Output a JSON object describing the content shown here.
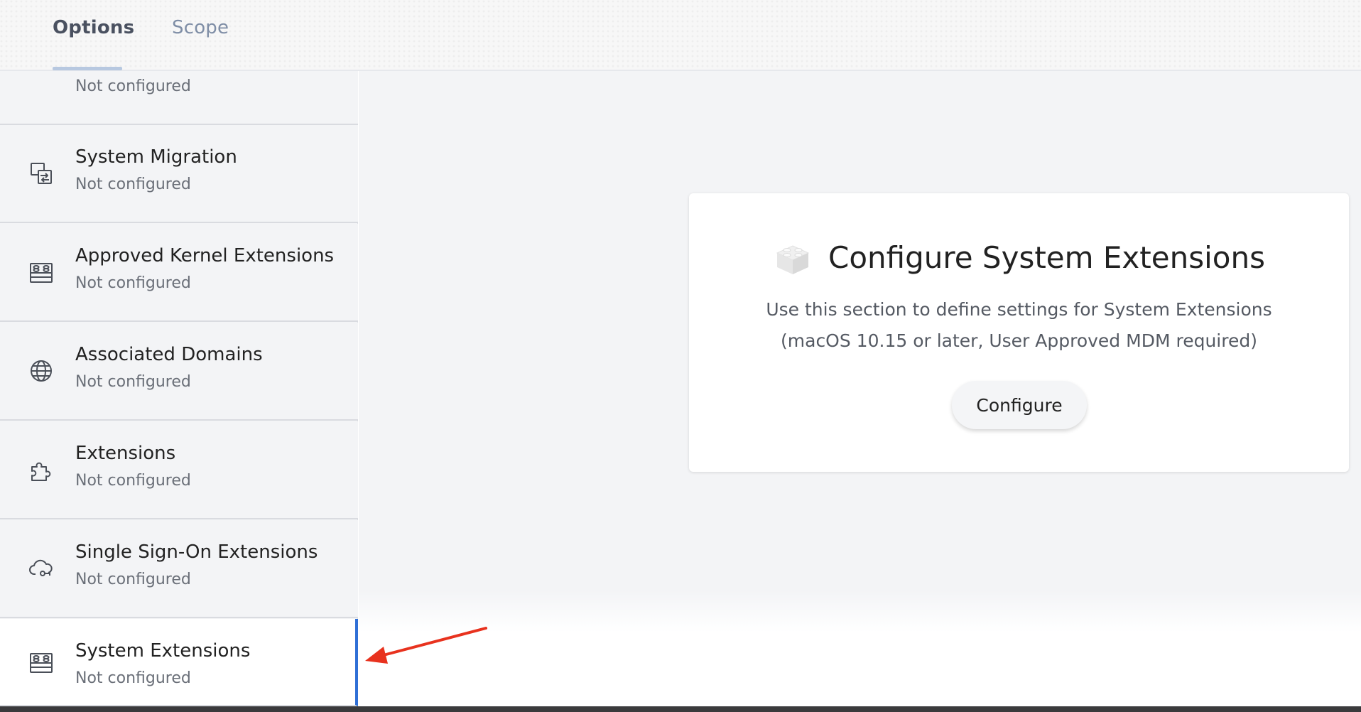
{
  "tabs": {
    "options": "Options",
    "scope": "Scope",
    "active": "options"
  },
  "sidebar": {
    "items": [
      {
        "title": "",
        "status": "Not configured",
        "icon": "document-icon"
      },
      {
        "title": "System Migration",
        "status": "Not configured",
        "icon": "migration-icon"
      },
      {
        "title": "Approved Kernel Extensions",
        "status": "Not configured",
        "icon": "brick-icon"
      },
      {
        "title": "Associated Domains",
        "status": "Not configured",
        "icon": "globe-icon"
      },
      {
        "title": "Extensions",
        "status": "Not configured",
        "icon": "puzzle-icon"
      },
      {
        "title": "Single Sign-On Extensions",
        "status": "Not configured",
        "icon": "cloud-key-icon"
      },
      {
        "title": "System Extensions",
        "status": "Not configured",
        "icon": "brick-icon",
        "selected": true
      }
    ]
  },
  "card": {
    "title": "Configure System Extensions",
    "description": "Use this section to define settings for System Extensions (macOS 10.15 or later, User Approved MDM required)",
    "button_label": "Configure",
    "icon": "lego-brick-icon"
  },
  "annotation": {
    "arrow_color": "#e8321e",
    "points_to": "System Extensions"
  },
  "colors": {
    "selection_accent": "#2f6fd6",
    "tab_active": "#4a5160",
    "tab_inactive": "#7f8ea6"
  }
}
